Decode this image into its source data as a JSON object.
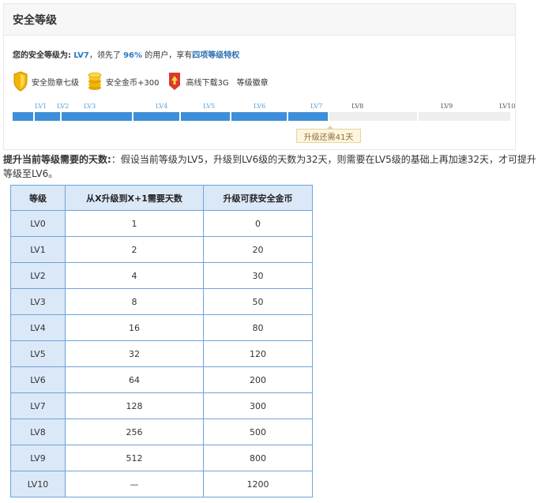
{
  "panel": {
    "title": "安全等级",
    "level_line": {
      "prefix": "您的安全等级为:",
      "level": "LV7",
      "middle": "，领先了",
      "percent": "96%",
      "suffix": "的用户，享有",
      "link": "四项等级特权"
    },
    "perks": [
      {
        "icon": "gold-shield-icon",
        "label": "安全勋章七级"
      },
      {
        "icon": "gold-coins-icon",
        "label": "安全金币+300"
      },
      {
        "icon": "download-badge-icon",
        "label": "高线下载3G"
      },
      {
        "icon": "",
        "label": "等级徽章"
      }
    ],
    "progress": {
      "labels": [
        "LV1",
        "LV2",
        "LV3",
        "LV4",
        "LV5",
        "LV6",
        "LV7",
        "LV8",
        "LV9",
        "LV10"
      ],
      "current_level_index": 7,
      "tooltip": "升级还需41天"
    }
  },
  "colors": {
    "progress_done": "#3d8fd9",
    "progress_todo": "#eeeeee",
    "table_border": "#6fa3d8",
    "table_header_bg": "#dbe8f8",
    "link_blue": "#2a6fb3"
  },
  "description": {
    "heading": "提升当前等级需要的天数:",
    "text": "：假设当前等级为LV5，升级到LV6级的天数为32天，则需要在LV5级的基础上再加速32天，才可提升等级至LV6。"
  },
  "table": {
    "headers": [
      "等级",
      "从X升级到X+1需要天数",
      "升级可获安全金币"
    ],
    "rows": [
      [
        "LV0",
        "1",
        "0"
      ],
      [
        "LV1",
        "2",
        "20"
      ],
      [
        "LV2",
        "4",
        "30"
      ],
      [
        "LV3",
        "8",
        "50"
      ],
      [
        "LV4",
        "16",
        "80"
      ],
      [
        "LV5",
        "32",
        "120"
      ],
      [
        "LV6",
        "64",
        "200"
      ],
      [
        "LV7",
        "128",
        "300"
      ],
      [
        "LV8",
        "256",
        "500"
      ],
      [
        "LV9",
        "512",
        "800"
      ],
      [
        "LV10",
        "—",
        "1200"
      ]
    ]
  }
}
